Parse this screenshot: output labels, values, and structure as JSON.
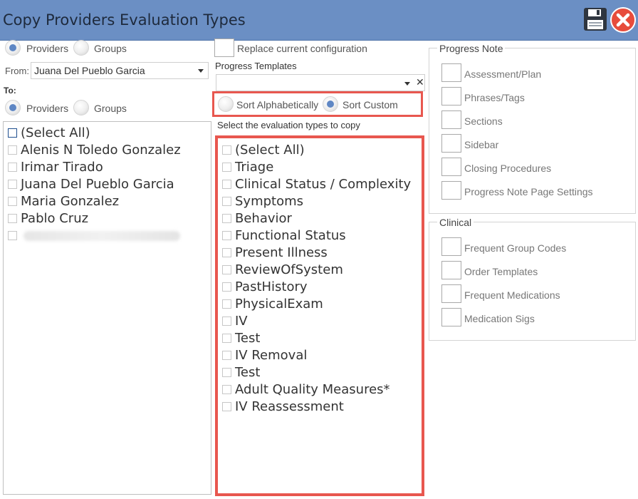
{
  "window": {
    "title": "Copy Providers Evaluation Types"
  },
  "icons": {
    "save": "floppy-disk-icon",
    "close": "close-circle-icon",
    "close_color": "#e74c3c",
    "accent": "#6b8fc4",
    "highlight": "#e8574f"
  },
  "from_section": {
    "providers_label": "Providers",
    "groups_label": "Groups",
    "from_label": "From:",
    "from_value": "Juana Del Pueblo Garcia"
  },
  "to_section": {
    "to_label": "To:",
    "providers_label": "Providers",
    "groups_label": "Groups",
    "items": [
      "(Select All)",
      "Alenis N Toledo Gonzalez",
      "Irimar Tirado",
      "Juana Del Pueblo Garcia",
      "Maria Gonzalez",
      "Pablo Cruz",
      ""
    ]
  },
  "middle": {
    "replace_label": "Replace current configuration",
    "templates_label": "Progress Templates",
    "templates_value": "",
    "sort_alpha_label": "Sort Alphabetically",
    "sort_custom_label": "Sort Custom",
    "select_label": "Select the evaluation types to copy",
    "eval_types": [
      "(Select All)",
      "Triage",
      "Clinical Status / Complexity",
      "Symptoms",
      "Behavior",
      "Functional Status",
      "Present Illness",
      "ReviewOfSystem",
      "PastHistory",
      "PhysicalExam",
      "IV",
      "Test",
      "IV Removal",
      "Test",
      "Adult Quality Measures*",
      "IV Reassessment"
    ]
  },
  "progress_note": {
    "title": "Progress Note",
    "items": [
      "Assessment/Plan",
      "Phrases/Tags",
      "Sections",
      "Sidebar",
      "Closing Procedures",
      "Progress Note Page Settings"
    ]
  },
  "clinical": {
    "title": "Clinical",
    "items": [
      "Frequent Group Codes",
      "Order Templates",
      "Frequent Medications",
      "Medication Sigs"
    ]
  }
}
